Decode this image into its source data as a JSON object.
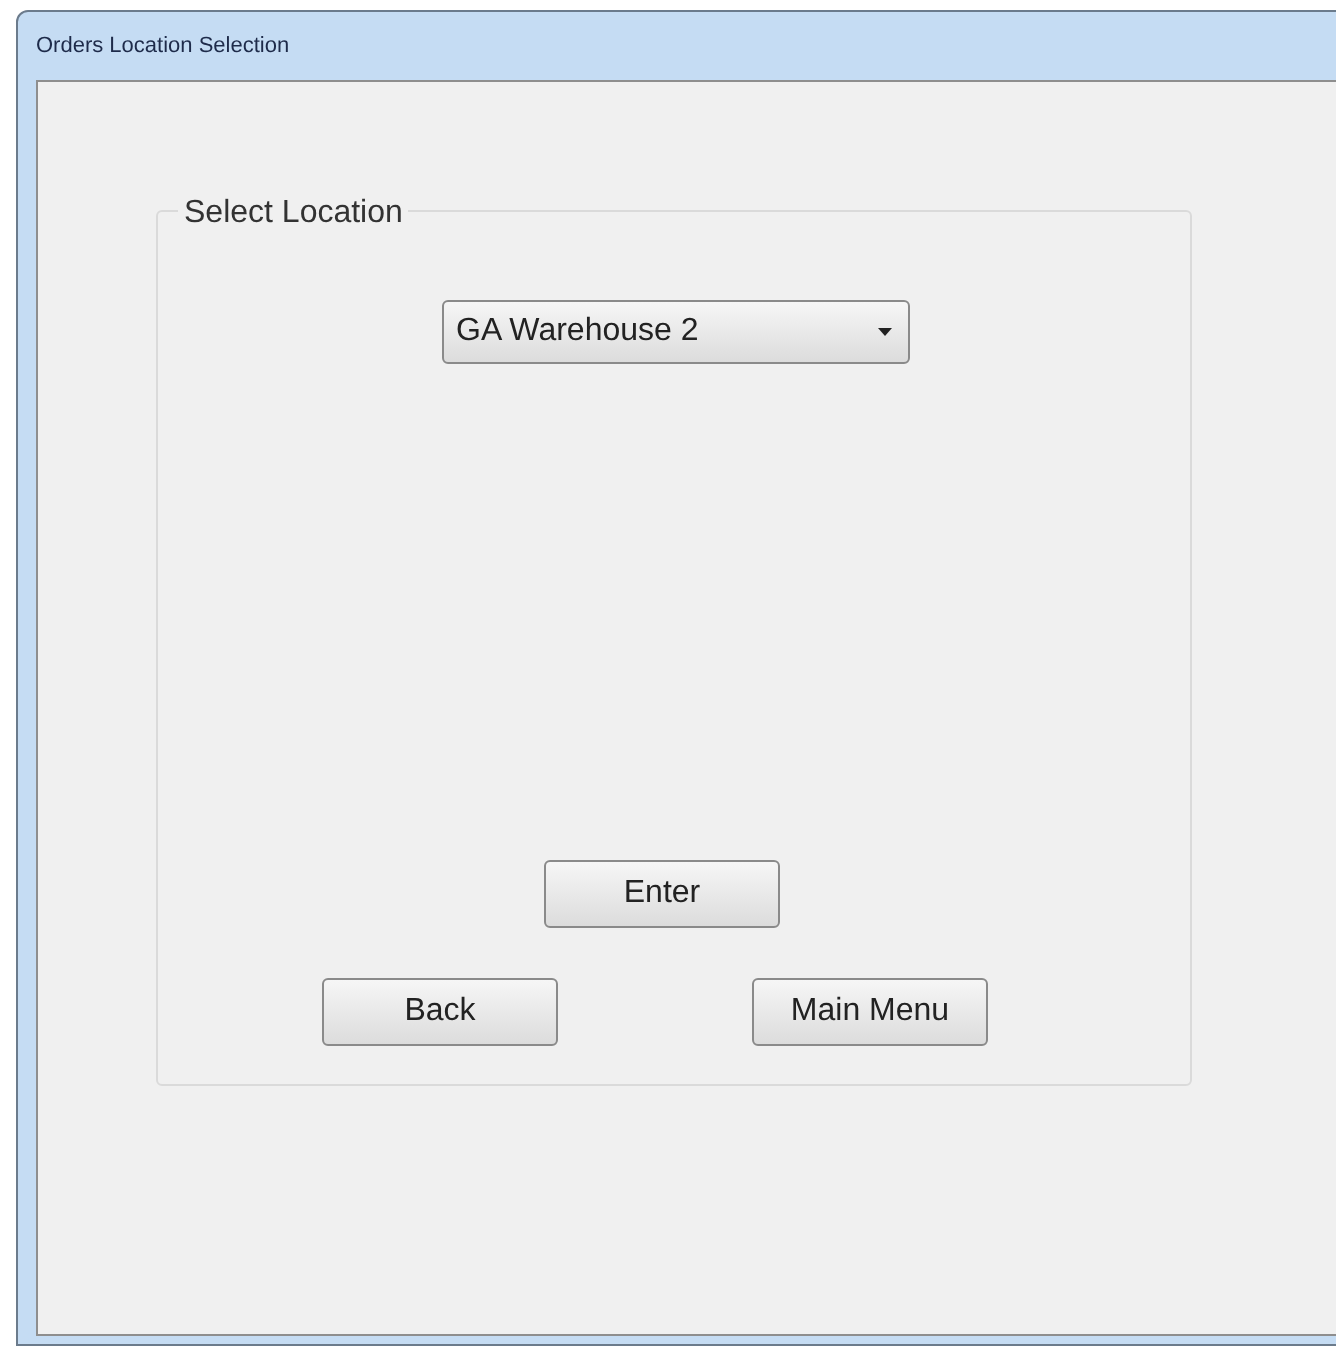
{
  "window": {
    "title": "Orders Location Selection"
  },
  "group": {
    "label": "Select Location"
  },
  "location_dropdown": {
    "value": "GA Warehouse 2"
  },
  "buttons": [
    {
      "label": "Enter"
    },
    {
      "label": "Back"
    },
    {
      "label": "Main Menu"
    }
  ]
}
